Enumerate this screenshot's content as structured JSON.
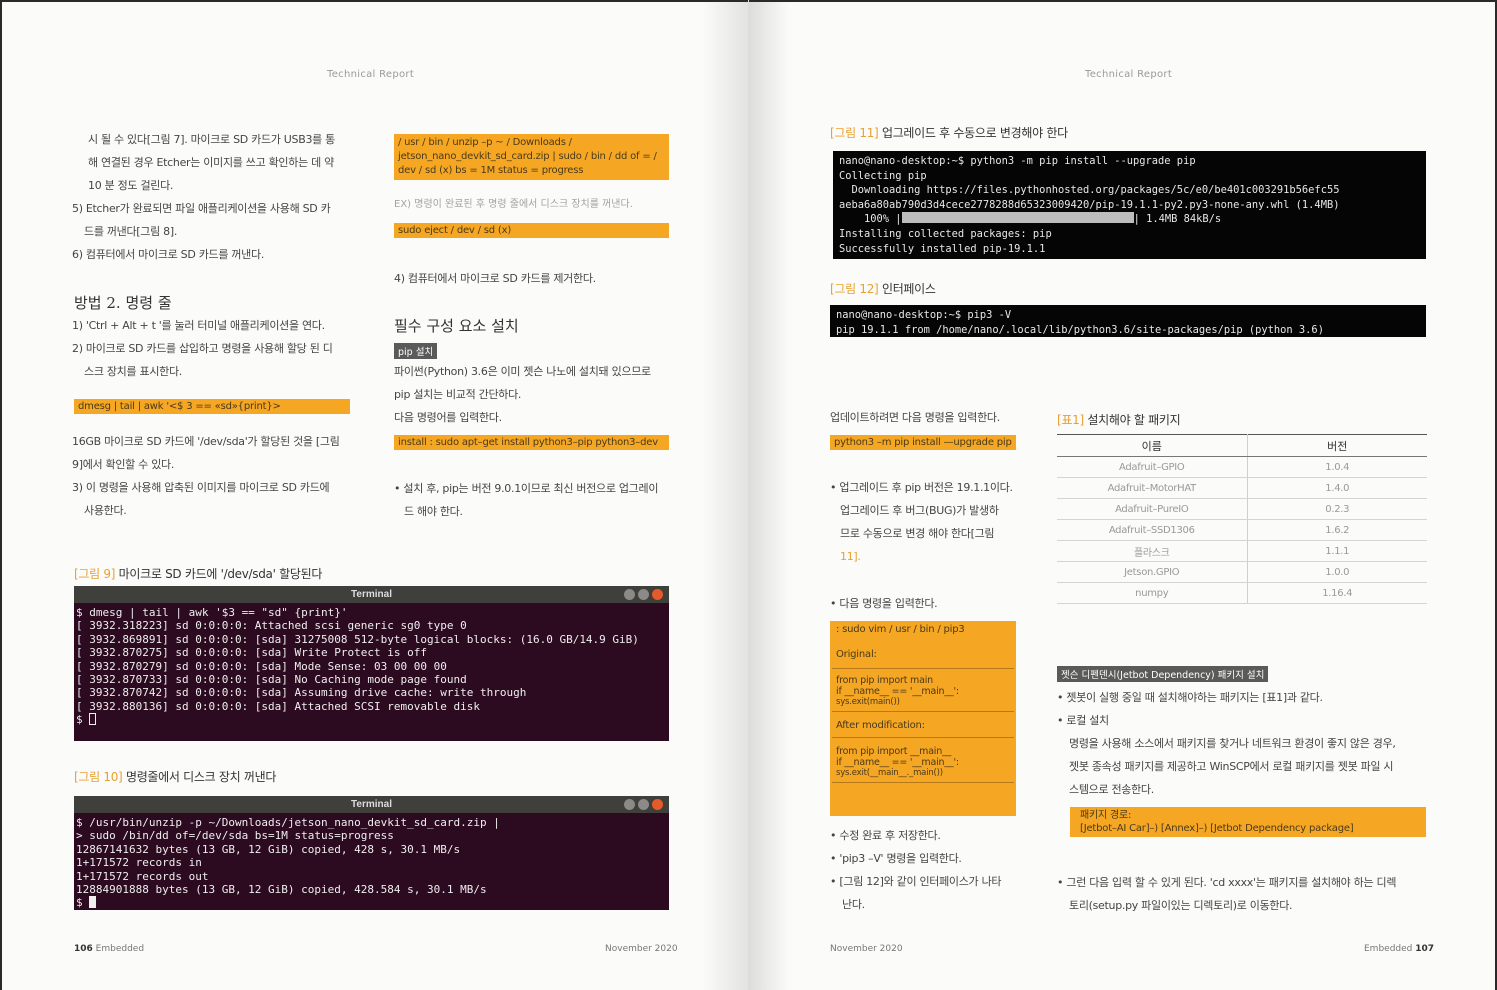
{
  "left": {
    "header": "Technical Report",
    "col1": {
      "intro_lines": [
        "시 될 수 있다[그림 7]. 마이크로 SD 카드가 USB3를 통",
        "해 연결된 경우 Etcher는 이미지를 쓰고 확인하는 데 약",
        "10 분 정도 걸린다.",
        "5) Etcher가 완료되면 파일 애플리케이션을 사용해 SD 카",
        "드를 꺼낸다[그림 8].",
        "6) 컴퓨터에서 마이크로 SD 카드를 꺼낸다."
      ],
      "method2_title": "방법 2. 명령 줄",
      "method2_lines": [
        "1) 'Ctrl + Alt + t '를 눌러 터미널 애플리케이션을 연다.",
        "2) 마이크로 SD 카드를 삽입하고 명령을 사용해 할당 된 디",
        "스크 장치를 표시한다."
      ],
      "dmesg_cmd": "dmesg | tail | awk '<$ 3 == «sd»{print}>",
      "after_lines": [
        "16GB 마이크로 SD 카드에 '/dev/sda'가 할당된 것을 [그림",
        "9]에서 확인할 수 있다.",
        "3) 이 명령을 사용해 압축된 이미지를 마이크로 SD 카드에",
        "사용한다."
      ]
    },
    "col2": {
      "unzip_cmd": [
        "/ usr / bin / unzip –p ~ / Downloads /",
        "jetson_nano_devkit_sd_card.zip | sudo / bin / dd of = /",
        "dev / sd (x) bs = 1M status = progress"
      ],
      "ex_note": "EX) 명령이 완료된 후 명령 줄에서 디스크 장치를 꺼낸다.",
      "eject_cmd": "sudo eject / dev / sd (x)",
      "remove_line": "4) 컴퓨터에서 마이크로 SD 카드를 제거한다.",
      "section_title": "필수 구성 요소 설치",
      "pip_badge": "pip 설치",
      "pip_lines": [
        "파이썬(Python) 3.6은 이미 젯슨 나노에 설치돼 있으므로",
        "pip 설치는 비교적 간단하다.",
        "다음 명령어를 입력한다."
      ],
      "install_cmd": "install : sudo apt–get install python3–pip python3–dev",
      "after_install": [
        "• 설치 후, pip는 버전 9.0.1이므로 최신 버전으로 업그레이",
        "드 해야 한다."
      ]
    },
    "fig9": {
      "label": "[그림 9]",
      "title": " 마이크로 SD 카드에 '/dev/sda' 할당된다",
      "terminal_title": "Terminal",
      "lines": [
        "$ dmesg | tail | awk '$3 == \"sd\" {print}'",
        "[ 3932.318223] sd 0:0:0:0: Attached scsi generic sg0 type 0",
        "[ 3932.869891] sd 0:0:0:0: [sda] 31275008 512-byte logical blocks: (16.0 GB/14.9 GiB)",
        "[ 3932.870275] sd 0:0:0:0: [sda] Write Protect is off",
        "[ 3932.870279] sd 0:0:0:0: [sda] Mode Sense: 03 00 00 00",
        "[ 3932.870733] sd 0:0:0:0: [sda] No Caching mode page found",
        "[ 3932.870742] sd 0:0:0:0: [sda] Assuming drive cache: write through",
        "[ 3932.880136] sd 0:0:0:0: [sda] Attached SCSI removable disk",
        "$ "
      ]
    },
    "fig10": {
      "label": "[그림 10]",
      "title": " 명령줄에서 디스크 장치 꺼낸다",
      "terminal_title": "Terminal",
      "lines": [
        "$ /usr/bin/unzip -p ~/Downloads/jetson_nano_devkit_sd_card.zip |",
        "> sudo /bin/dd of=/dev/sda bs=1M status=progress",
        "12867141632 bytes (13 GB, 12 GiB) copied, 428 s, 30.1 MB/s",
        "1+171572 records in",
        "1+171572 records out",
        "12884901888 bytes (13 GB, 12 GiB) copied, 428.584 s, 30.1 MB/s",
        "$ "
      ]
    },
    "footer": {
      "page_num": "106",
      "section": "Embedded",
      "date": "November 2020"
    }
  },
  "right": {
    "header": "Technical Report",
    "fig11": {
      "label": "[그림 11]",
      "title": " 업그레이드 후 수동으로 변경해야 한다",
      "lines": [
        "nano@nano-desktop:~$ python3 -m pip install --upgrade pip",
        "Collecting pip",
        "  Downloading https://files.pythonhosted.org/packages/5c/e0/be401c003291b56efc55",
        "aeba6a80ab790d3d4cece2778288d65323009420/pip-19.1.1-py2.py3-none-any.whl (1.4MB)",
        "    100% |",
        "| 1.4MB 84kB/s",
        "Installing collected packages: pip",
        "Successfully installed pip-19.1.1"
      ]
    },
    "fig12": {
      "label": "[그림 12]",
      "title": " 인터페이스",
      "lines": [
        "nano@nano-desktop:~$ pip3 -V",
        "pip 19.1.1 from /home/nano/.local/lib/python3.6/site-packages/pip (python 3.6)"
      ]
    },
    "col1": {
      "intro": "업데이트하려면 다음 명령을 입력한다.",
      "upgrade_cmd": "python3 –m pip install —upgrade pip",
      "bullet1_lines": [
        "• 업그레이드 후 pip 버전은 19.1.1이다.",
        "업그레이드 후 버그(BUG)가 발생하",
        "므로 수동으로 변경 해야 한다[그림",
        "11]."
      ],
      "bullet2": "• 다음 명령을 입력한다.",
      "box_rows": [
        ": sudo vim / usr / bin / pip3",
        "Original:",
        "from pip import main",
        "if __name__ == '__main__':",
        "sys.exit(main())",
        "After modification:",
        "from pip import __main__",
        "if __name__ == '__main__':",
        "sys.exit(__main__._main())"
      ],
      "after_box": [
        "• 수정 완료 후 저장한다.",
        "• 'pip3 –V' 명령을 입력한다.",
        "• [그림 12]와 같이 인터페이스가 나타",
        "난다."
      ]
    },
    "table1": {
      "label": "[표1]",
      "title": " 설치해야 할 패키지",
      "headers": [
        "이름",
        "버전"
      ],
      "rows": [
        [
          "Adafruit–GPIO",
          "1.0.4"
        ],
        [
          "Adafruit–MotorHAT",
          "1.4.0"
        ],
        [
          "Adafruit–PureIO",
          "0.2.3"
        ],
        [
          "Adafruit–SSD1306",
          "1.6.2"
        ],
        [
          "플라스크",
          "1.1.1"
        ],
        [
          "Jetson.GPIO",
          "1.0.0"
        ],
        [
          "numpy",
          "1.16.4"
        ]
      ]
    },
    "col2": {
      "badge": "젯슨 디펜덴시(Jetbot Dependency) 패키지 설치",
      "bullet1": "• 젯봇이 실행 중일 때 설치해야하는 패키지는 [표1]과 같다.",
      "bullet2": "• 로컬 설치",
      "local_lines": [
        "명령을 사용해 소스에서 패키지를 찾거나 네트워크 환경이 좋지 않은 경우,",
        "젯봇 종속성 패키지를 제공하고 WinSCP에서 로컬 패키지를 젯봇 파일 시",
        "스템으로 전송한다."
      ],
      "path_box": [
        "패키지 경로:",
        "[Jetbot–AI Car]–) [Annex]–) [Jetbot Dependency package]"
      ],
      "final_lines": [
        "• 그런 다음 입력 할 수 있게 된다. 'cd xxxx'는 패키지를 설치해야 하는 디렉",
        "토리(setup.py 파일이있는 디렉토리)로 이동한다."
      ]
    },
    "footer": {
      "date": "November 2020",
      "section": "Embedded",
      "page_num": "107"
    }
  },
  "colors": {
    "accent_orange": "#f5a623",
    "terminal_purple": "#2c0a1f",
    "terminal_black": "#050505"
  }
}
